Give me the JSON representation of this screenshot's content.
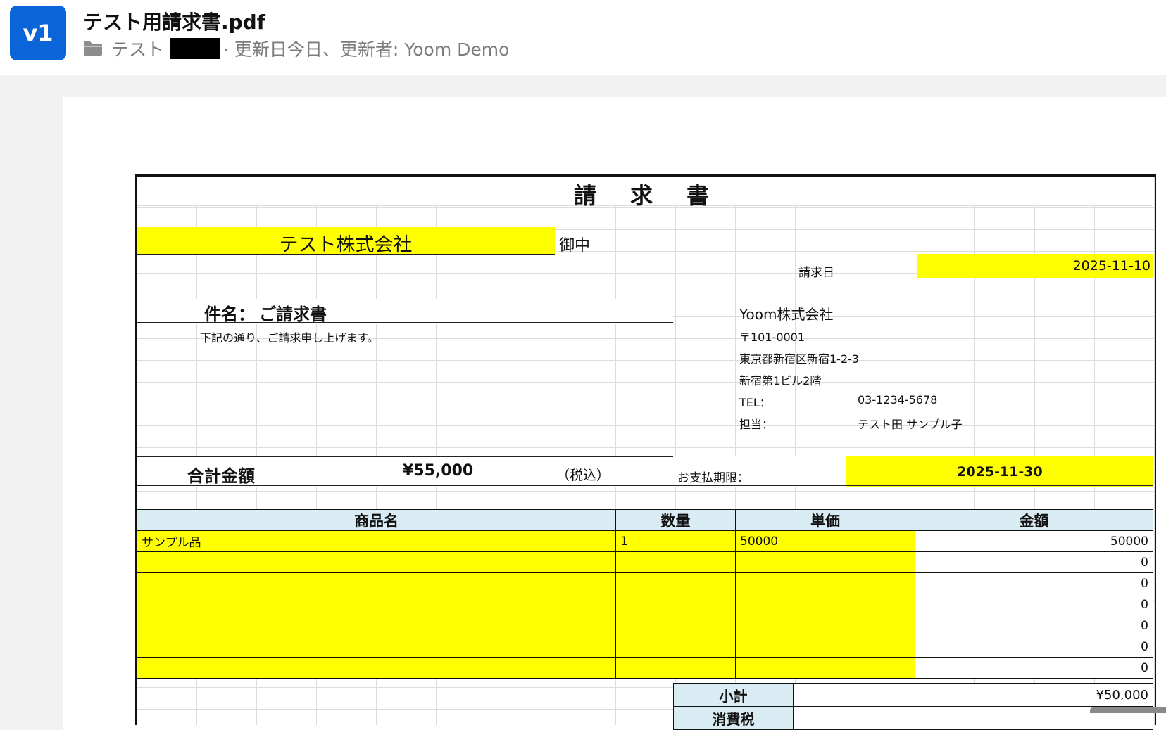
{
  "header": {
    "version_badge": "v1",
    "file_title": "テスト用請求書.pdf",
    "folder_name": "テスト",
    "meta_text": "· 更新日今日、更新者: Yoom Demo",
    "folder_icon": "folder-icon"
  },
  "invoice": {
    "title": "請　求　書",
    "recipient": "テスト株式会社",
    "recipient_suffix": "御中",
    "invoice_date_label": "請求日",
    "invoice_date": "2025-11-10",
    "subject_label": "件名：",
    "subject": "ご請求書",
    "intro": "下記の通り、ご請求申し上げます。",
    "company": "Yoom株式会社",
    "postal": "〒101-0001",
    "address1": "東京都新宿区新宿1-2-3",
    "address2": "新宿第1ビル2階",
    "tel_label": "TEL：",
    "tel": "03-1234-5678",
    "contact_label": "担当：",
    "contact": "テスト田 サンプル子",
    "total_label": "合計金額",
    "total": "¥55,000",
    "tax_note": "（税込）",
    "due_label": "お支払期限：",
    "due_date": "2025-11-30",
    "columns": [
      "商品名",
      "数量",
      "単価",
      "金額"
    ],
    "rows": [
      {
        "name": "サンプル品",
        "qty": "1",
        "unit": "50000",
        "amount": "50000"
      },
      {
        "name": "",
        "qty": "",
        "unit": "",
        "amount": "0"
      },
      {
        "name": "",
        "qty": "",
        "unit": "",
        "amount": "0"
      },
      {
        "name": "",
        "qty": "",
        "unit": "",
        "amount": "0"
      },
      {
        "name": "",
        "qty": "",
        "unit": "",
        "amount": "0"
      },
      {
        "name": "",
        "qty": "",
        "unit": "",
        "amount": "0"
      },
      {
        "name": "",
        "qty": "",
        "unit": "",
        "amount": "0"
      }
    ],
    "subtotal_label": "小計",
    "subtotal": "¥50,000",
    "tax_label": "消費税"
  },
  "colors": {
    "badge": "#0a66d8",
    "highlight": "#ffff00",
    "header_cell": "#d9ecf4"
  }
}
